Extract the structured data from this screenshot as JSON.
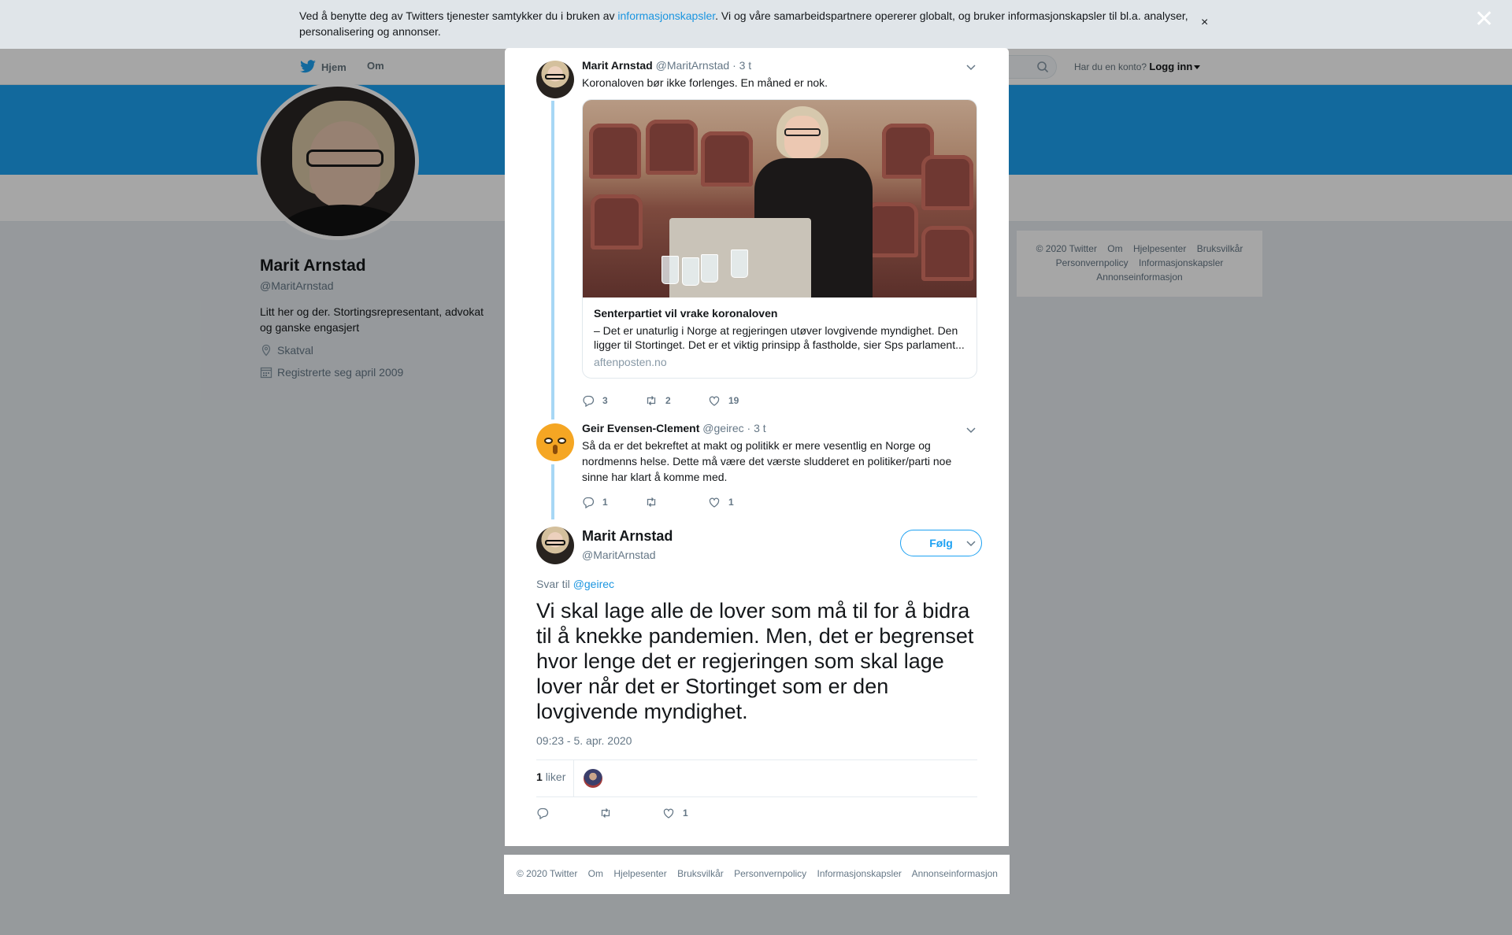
{
  "cookie_bar": {
    "text_before": "Ved å benytte deg av Twitters tjenester samtykker du i bruken av ",
    "link": "informasjonskapsler",
    "text_after": ". Vi og våre samarbeidspartnere opererer globalt, og bruker informasjonskapsler til bl.a. analyser, personalisering og annonser.",
    "close": "×"
  },
  "modal_close": "✕",
  "nav": {
    "home": "Hjem",
    "about": "Om",
    "account_prompt": "Har du en konto?",
    "login": "Logg inn"
  },
  "profile": {
    "name": "Marit Arnstad",
    "handle": "@MaritArnstad",
    "bio": "Litt her og der. Stortingsrepresentant, advokat og ganske engasjert",
    "location": "Skatval",
    "joined": "Registrerte seg april 2009"
  },
  "side_footer": {
    "items": [
      "© 2020 Twitter",
      "Om",
      "Hjelpesenter",
      "Bruksvilkår",
      "Personvernpolicy",
      "Informasjonskapsler",
      "Annonseinformasjon"
    ]
  },
  "tweet1": {
    "name": "Marit Arnstad",
    "handle": "@MaritArnstad",
    "time": "· 3 t",
    "text": "Koronaloven bør ikke forlenges. En måned er nok.",
    "card": {
      "title": "Senterpartiet vil vrake koronaloven",
      "description": "– Det er unaturlig i Norge at regjeringen utøver lovgivende myndighet. Den ligger til Stortinget. Det er et viktig prinsipp å fastholde, sier Sps parlament...",
      "url": "aftenposten.no"
    },
    "replies": "3",
    "retweets": "2",
    "likes": "19"
  },
  "tweet2": {
    "name": "Geir Evensen-Clement",
    "handle": "@geirec",
    "time": "· 3 t",
    "text": "Så da er det bekreftet at makt og politikk er mere vesentlig en Norge og nordmenns helse. Dette må være det værste sludderet en politiker/parti noe sinne har klart å komme med.",
    "replies": "1",
    "retweets": "",
    "likes": "1"
  },
  "main_tweet": {
    "name": "Marit Arnstad",
    "handle": "@MaritArnstad",
    "follow": "Følg",
    "reply_to_label": "Svar til",
    "reply_to_handle": "@geirec",
    "text": "Vi skal lage alle de lover som må til for å bidra til å knekke pandemien. Men, det er begrenset hvor lenge det er regjeringen som skal lage lover når det er Stortinget som er den lovgivende myndighet.",
    "timestamp": "09:23 - 5. apr. 2020",
    "likes_count": "1",
    "likes_label": "liker",
    "action_likes": "1"
  },
  "modal_footer": {
    "items": [
      "© 2020 Twitter",
      "Om",
      "Hjelpesenter",
      "Bruksvilkår",
      "Personvernpolicy",
      "Informasjonskapsler",
      "Annonseinformasjon"
    ]
  },
  "colors": {
    "accent": "#1da1f2",
    "link": "#1b95e0",
    "thread_line": "#a7d7f5",
    "background": "#e6ecf0"
  },
  "icons": [
    "twitter-bird-icon",
    "search-icon",
    "location-pin-icon",
    "calendar-icon",
    "chevron-down-icon",
    "reply-icon",
    "retweet-icon",
    "heart-icon",
    "close-icon"
  ]
}
